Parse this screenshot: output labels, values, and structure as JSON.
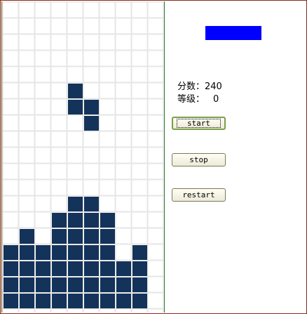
{
  "colors": {
    "block": "#14335a",
    "grid_line": "#e6e6e6",
    "next_piece": "#0000ff"
  },
  "board": {
    "cols": 10,
    "rows": 19,
    "filled_cells": [
      [
        4,
        5
      ],
      [
        4,
        6
      ],
      [
        5,
        6
      ],
      [
        5,
        7
      ],
      [
        4,
        12
      ],
      [
        5,
        12
      ],
      [
        3,
        13
      ],
      [
        4,
        13
      ],
      [
        5,
        13
      ],
      [
        6,
        13
      ],
      [
        1,
        14
      ],
      [
        3,
        14
      ],
      [
        4,
        14
      ],
      [
        5,
        14
      ],
      [
        6,
        14
      ],
      [
        0,
        15
      ],
      [
        1,
        15
      ],
      [
        2,
        15
      ],
      [
        3,
        15
      ],
      [
        4,
        15
      ],
      [
        5,
        15
      ],
      [
        6,
        15
      ],
      [
        8,
        15
      ],
      [
        0,
        16
      ],
      [
        1,
        16
      ],
      [
        2,
        16
      ],
      [
        3,
        16
      ],
      [
        4,
        16
      ],
      [
        5,
        16
      ],
      [
        6,
        16
      ],
      [
        7,
        16
      ],
      [
        8,
        16
      ],
      [
        0,
        17
      ],
      [
        1,
        17
      ],
      [
        2,
        17
      ],
      [
        3,
        17
      ],
      [
        4,
        17
      ],
      [
        5,
        17
      ],
      [
        6,
        17
      ],
      [
        7,
        17
      ],
      [
        8,
        17
      ],
      [
        0,
        18
      ],
      [
        1,
        18
      ],
      [
        2,
        18
      ],
      [
        3,
        18
      ],
      [
        4,
        18
      ],
      [
        5,
        18
      ],
      [
        6,
        18
      ],
      [
        7,
        18
      ],
      [
        8,
        18
      ]
    ]
  },
  "stats": {
    "score_label": "分数：",
    "score_value": "240",
    "level_label": "等级：",
    "level_value": "0"
  },
  "controls": {
    "start_label": "start",
    "stop_label": "stop",
    "restart_label": "restart"
  }
}
